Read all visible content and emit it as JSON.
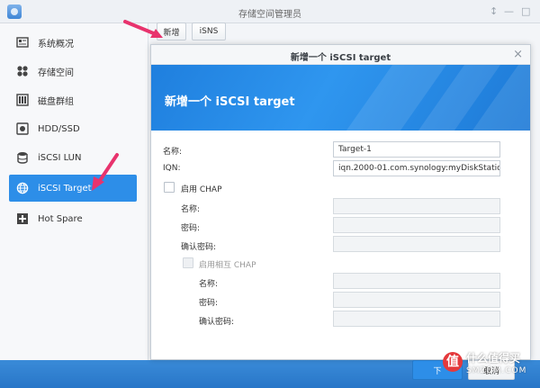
{
  "window": {
    "title": "存储空间管理员",
    "pin_label": "↕",
    "minimize_label": "—",
    "maximize_label": "□"
  },
  "sidebar": {
    "items": [
      {
        "label": "系统概况",
        "icon": "overview-icon"
      },
      {
        "label": "存储空间",
        "icon": "storage-icon"
      },
      {
        "label": "磁盘群组",
        "icon": "disk-group-icon"
      },
      {
        "label": "HDD/SSD",
        "icon": "hdd-icon"
      },
      {
        "label": "iSCSI LUN",
        "icon": "lun-icon"
      },
      {
        "label": "iSCSI Target",
        "icon": "globe-icon",
        "active": true
      },
      {
        "label": "Hot Spare",
        "icon": "hot-spare-icon"
      }
    ]
  },
  "toolbar": {
    "create_label": "新增",
    "isns_label": "iSNS"
  },
  "dialog": {
    "title": "新增一个 iSCSI target",
    "close_label": "×",
    "banner_title": "新增一个 iSCSI target",
    "name_label": "名称:",
    "name_value": "Target-1",
    "iqn_label": "IQN:",
    "iqn_value": "iqn.2000-01.com.synology:myDiskStation.Ta",
    "chap": {
      "label": "启用 CHAP",
      "name_label": "名称:",
      "password_label": "密码:",
      "confirm_label": "确认密码:"
    },
    "mutual_chap": {
      "label": "启用相互 CHAP",
      "name_label": "名称:",
      "password_label": "密码:",
      "confirm_label": "确认密码:"
    },
    "next_label": "下",
    "cancel_label": "取消"
  },
  "watermark": {
    "badge": "值",
    "line1": "什么值得买",
    "line2": "SMZDM.COM"
  },
  "colors": {
    "accent": "#2d8ee8",
    "banner": "#1f7fde",
    "arrow": "#e8336d"
  }
}
